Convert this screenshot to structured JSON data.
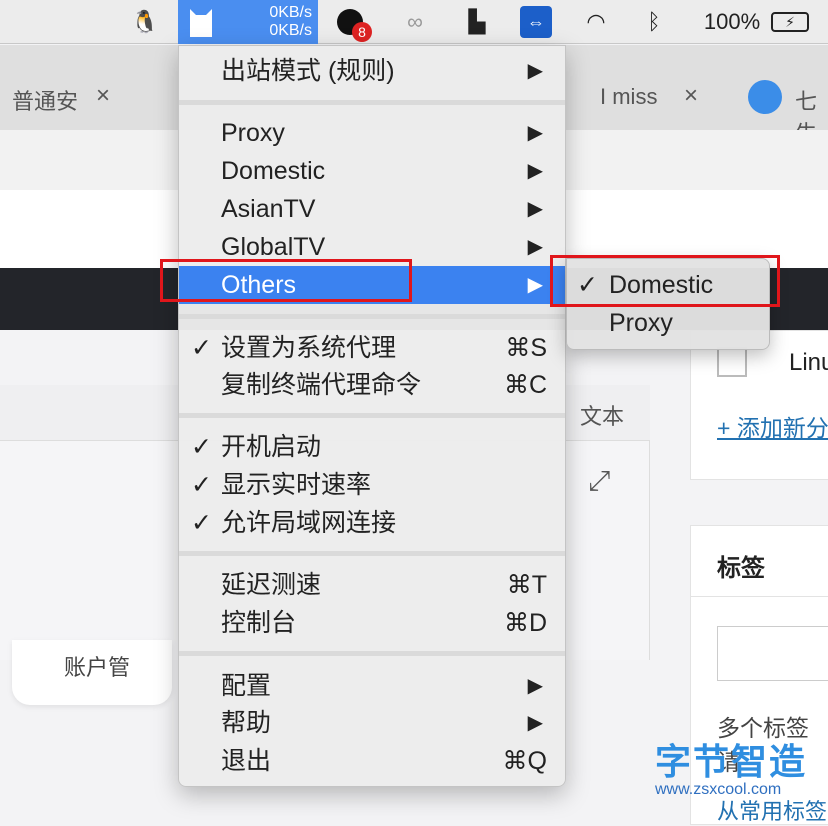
{
  "menubar": {
    "speed_up": "0KB/s",
    "speed_down": "0KB/s",
    "badge": "8",
    "battery": "100%"
  },
  "tabs": [
    {
      "label": "普通安"
    },
    {
      "label": "I miss"
    },
    {
      "label": "七牛"
    }
  ],
  "background": {
    "tab_text": "文本",
    "checkbox_label": "Linu",
    "add_link": "+ 添加新分",
    "tags_title": "标签",
    "tags_hint": "多个标签请",
    "tags_hint2": "从常用标签",
    "card_text": "账户管"
  },
  "watermark": {
    "title": "字节智造",
    "url": "www.zsxcool.com"
  },
  "menu": {
    "mode": "出站模式 (规则)",
    "groups": [
      "Proxy",
      "Domestic",
      "AsianTV",
      "GlobalTV",
      "Others"
    ],
    "set_system_proxy": {
      "label": "设置为系统代理",
      "checked": true,
      "shortcut": "⌘S"
    },
    "copy_cmd": {
      "label": "复制终端代理命令",
      "shortcut": "⌘C"
    },
    "startup": {
      "label": "开机启动",
      "checked": true
    },
    "show_speed": {
      "label": "显示实时速率",
      "checked": true
    },
    "allow_lan": {
      "label": "允许局域网连接",
      "checked": true
    },
    "latency": {
      "label": "延迟测速",
      "shortcut": "⌘T"
    },
    "dashboard": {
      "label": "控制台",
      "shortcut": "⌘D"
    },
    "config": "配置",
    "help": "帮助",
    "quit": {
      "label": "退出",
      "shortcut": "⌘Q"
    },
    "check": "✓",
    "arrow": "▶"
  },
  "submenu": {
    "items": [
      {
        "label": "Domestic",
        "checked": true
      },
      {
        "label": "Proxy",
        "checked": false
      }
    ]
  },
  "colors": {
    "highlight": "#3b82f0",
    "annotation": "#e0161b"
  }
}
